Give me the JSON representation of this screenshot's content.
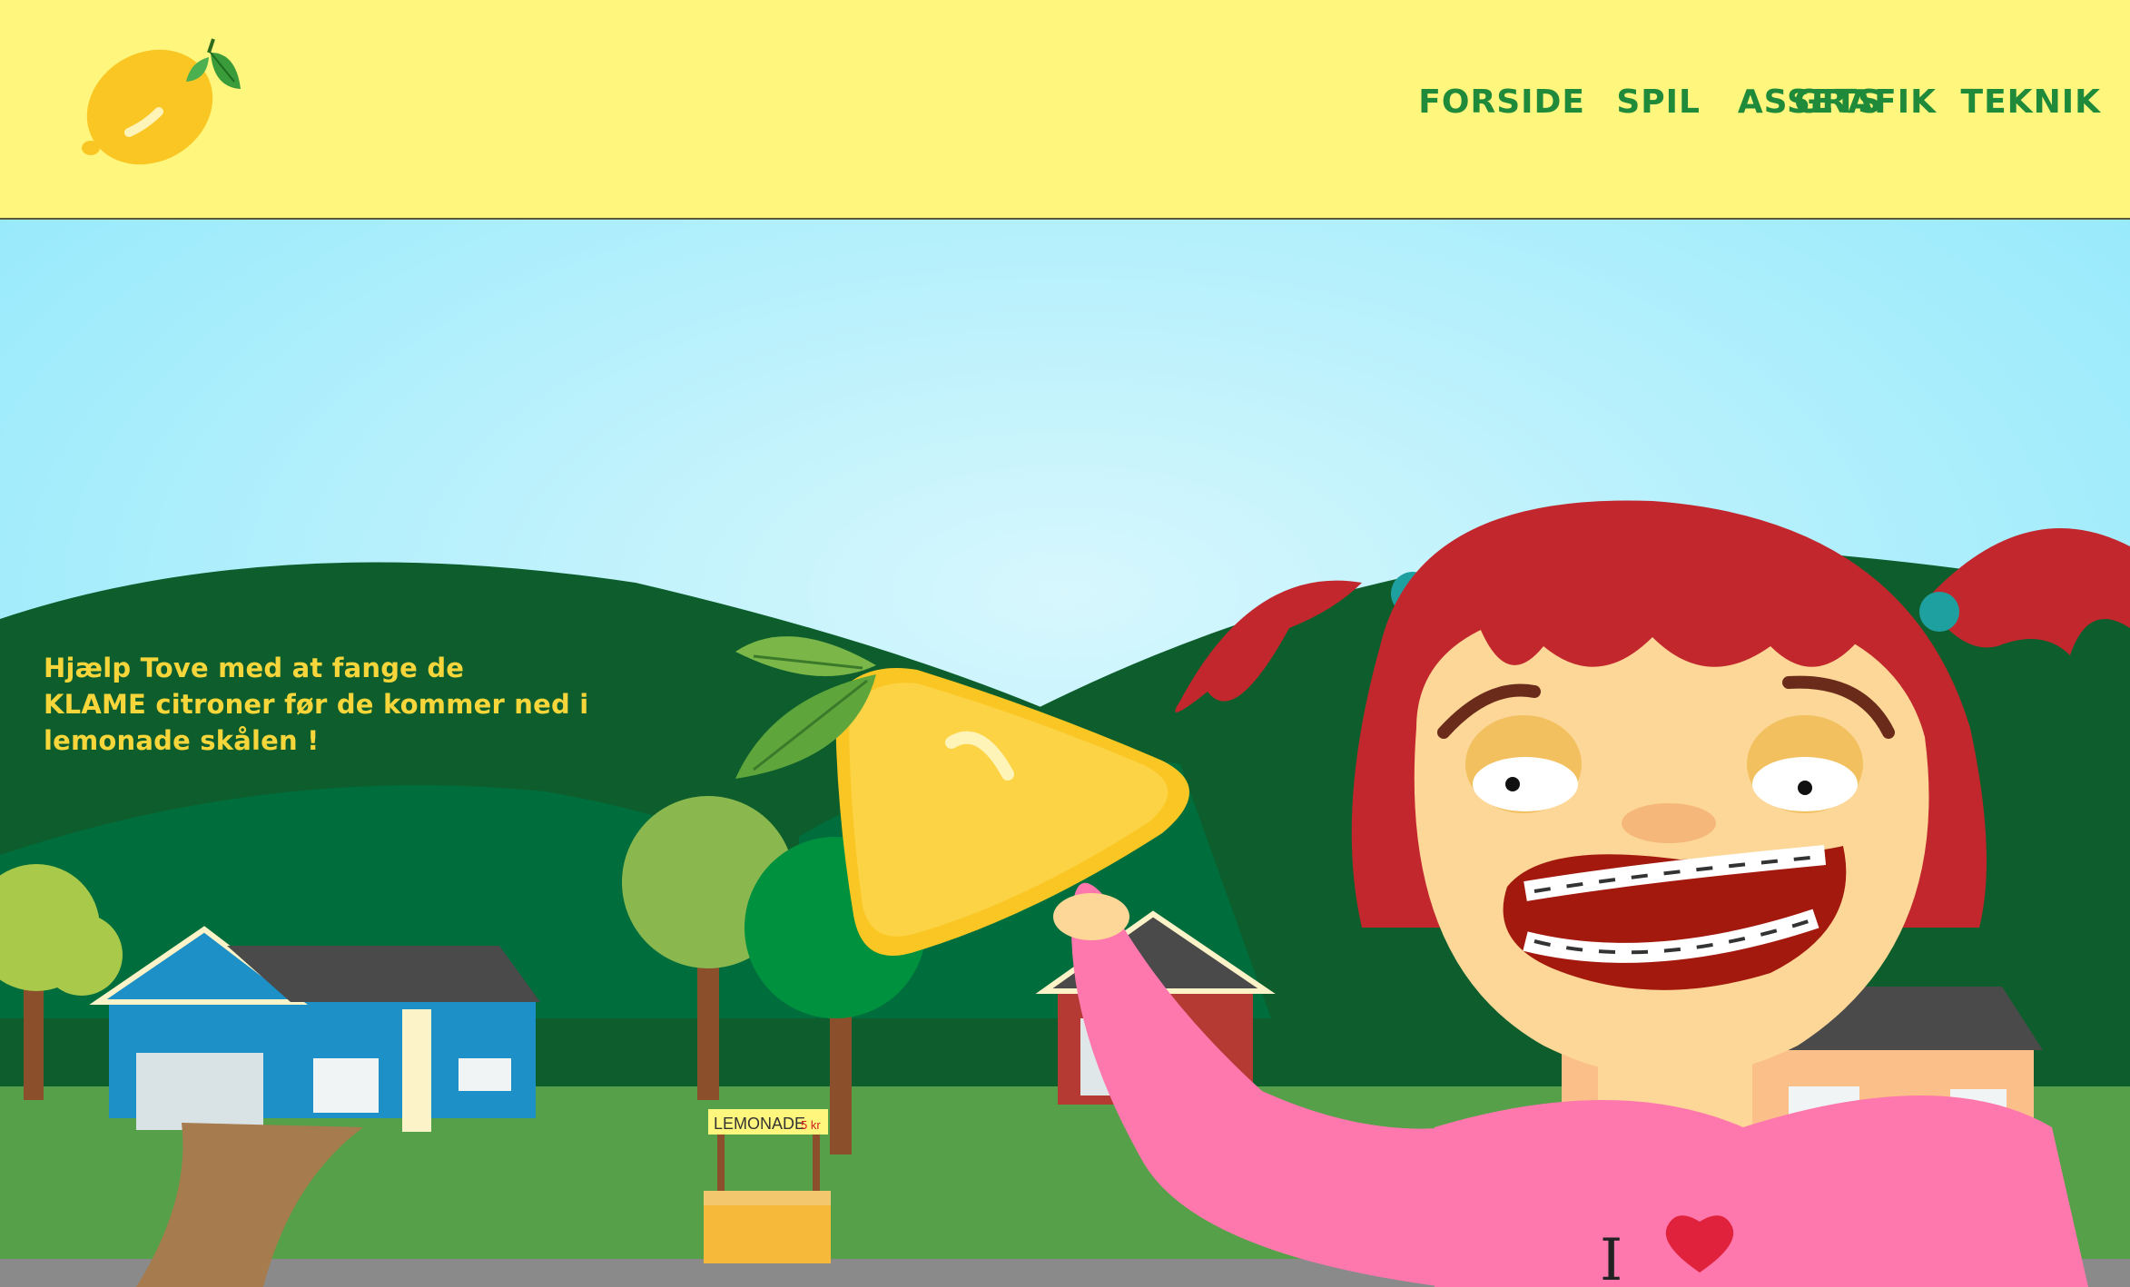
{
  "header": {
    "logo_icon": "lemon-icon",
    "background_color": "#fff67d",
    "nav_color": "#1f8a3a",
    "nav": [
      {
        "label": "FORSIDE"
      },
      {
        "label": "SPIL"
      },
      {
        "label": "GRAFIK"
      },
      {
        "label": "ASSETS"
      },
      {
        "label": "TEKNIK"
      }
    ]
  },
  "hero": {
    "intro_lines": [
      "Hjælp Tove med at fange de",
      "KLAME citroner før de kommer ned i",
      "lemonade skålen !"
    ],
    "intro_color": "#f6d63a",
    "play_icon": "lemon-play-icon",
    "stand_sign": "LEMONADE",
    "stand_price": "5 kr",
    "shirt_text": "I",
    "shirt_icon": "heart-icon",
    "colors": {
      "sky_top": "#8fe8fb",
      "sky_glow": "#d7f7fd",
      "hill_dark": "#0d5e2c",
      "grass": "#56a04a",
      "hair": "#c1272d",
      "shirt": "#ff78ad"
    }
  }
}
